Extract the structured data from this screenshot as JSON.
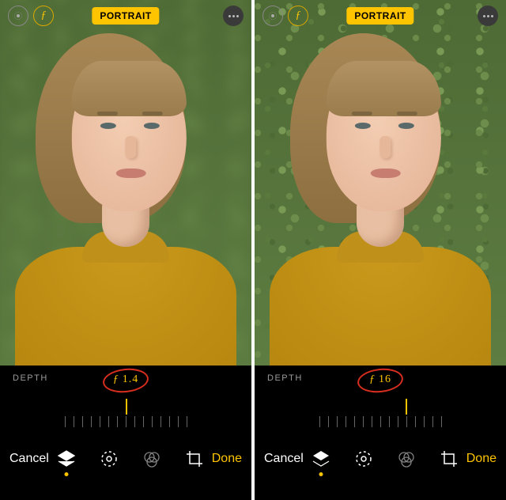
{
  "left": {
    "mode_badge": "PORTRAIT",
    "depth_label": "DEPTH",
    "f_value": "1.4",
    "cancel_label": "Cancel",
    "done_label": "Done",
    "slider": {
      "pointer_pct": 50,
      "tick_count": 15
    }
  },
  "right": {
    "mode_badge": "PORTRAIT",
    "depth_label": "DEPTH",
    "f_value": "16",
    "cancel_label": "Cancel",
    "done_label": "Done",
    "slider": {
      "pointer_pct": 60,
      "tick_count": 15
    }
  },
  "icons": {
    "live_photo": "live-photo-icon",
    "aperture": "aperture-icon",
    "more": "more-icon",
    "lighting": "portrait-lighting-icon",
    "adjust": "adjust-icon",
    "filters": "filters-icon",
    "crop": "crop-icon"
  },
  "colors": {
    "accent": "#ffc400",
    "annotation_ring": "#d82e1f",
    "panel_bg": "#000000"
  }
}
